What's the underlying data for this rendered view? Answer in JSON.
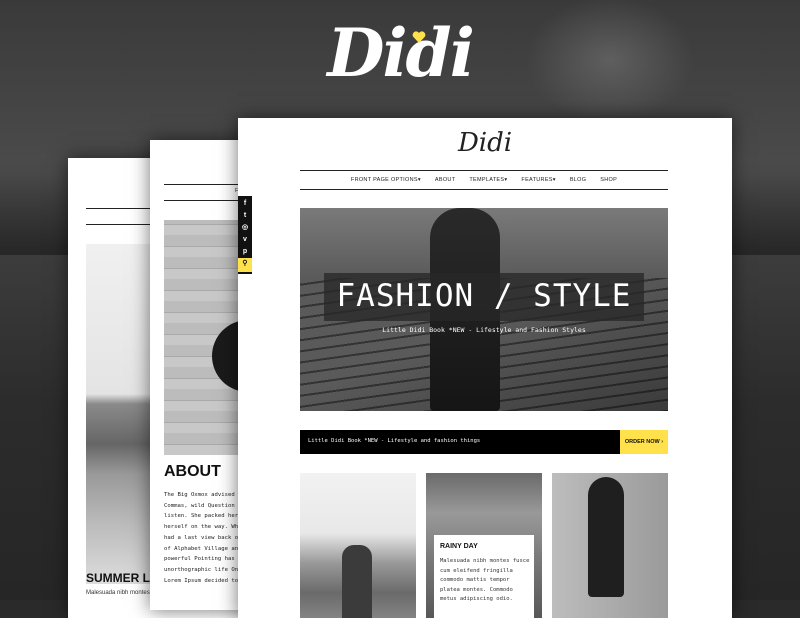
{
  "brand": {
    "logo_text": "Didi",
    "accent_color": "#ffe24b"
  },
  "back_page": {
    "section_title": "SUMMER LOOK",
    "snippet": "Malesuada nibh montes"
  },
  "middle_page": {
    "about_title": "ABOUT",
    "about_lines": [
      "The Big Oxmox advised her",
      "Commas, wild Question Mark",
      "listen. She packed her sev",
      "herself on the way. When s",
      "had a last view back on th",
      "of Alphabet Village and th",
      "powerful Pointing has no c",
      "unorthographic life One d",
      "Lorem Ipsum decided to lea"
    ],
    "nav_partial": "F"
  },
  "social": {
    "icons": [
      "facebook-icon",
      "twitter-icon",
      "instagram-icon",
      "vimeo-icon",
      "pinterest-icon",
      "search-icon"
    ]
  },
  "front_page": {
    "logo": "Didi",
    "nav": [
      "FRONT PAGE OPTIONS▾",
      "ABOUT",
      "TEMPLATES▾",
      "FEATURES▾",
      "BLOG",
      "SHOP"
    ],
    "hero_title": "FASHION / STYLE",
    "hero_subtitle": "Little Didi Book *NEW - Lifestyle and Fashion Styles",
    "banner_text": "Little Didi Book *NEW - Lifestyle and fashion things",
    "order_button": "ORDER NOW  ›",
    "card": {
      "title": "RAINY DAY",
      "text": "Malesuada nibh montes fusce cum eleifend fringilla commodo mattis tempor platea montes. Commodo metus adipiscing odio."
    }
  }
}
